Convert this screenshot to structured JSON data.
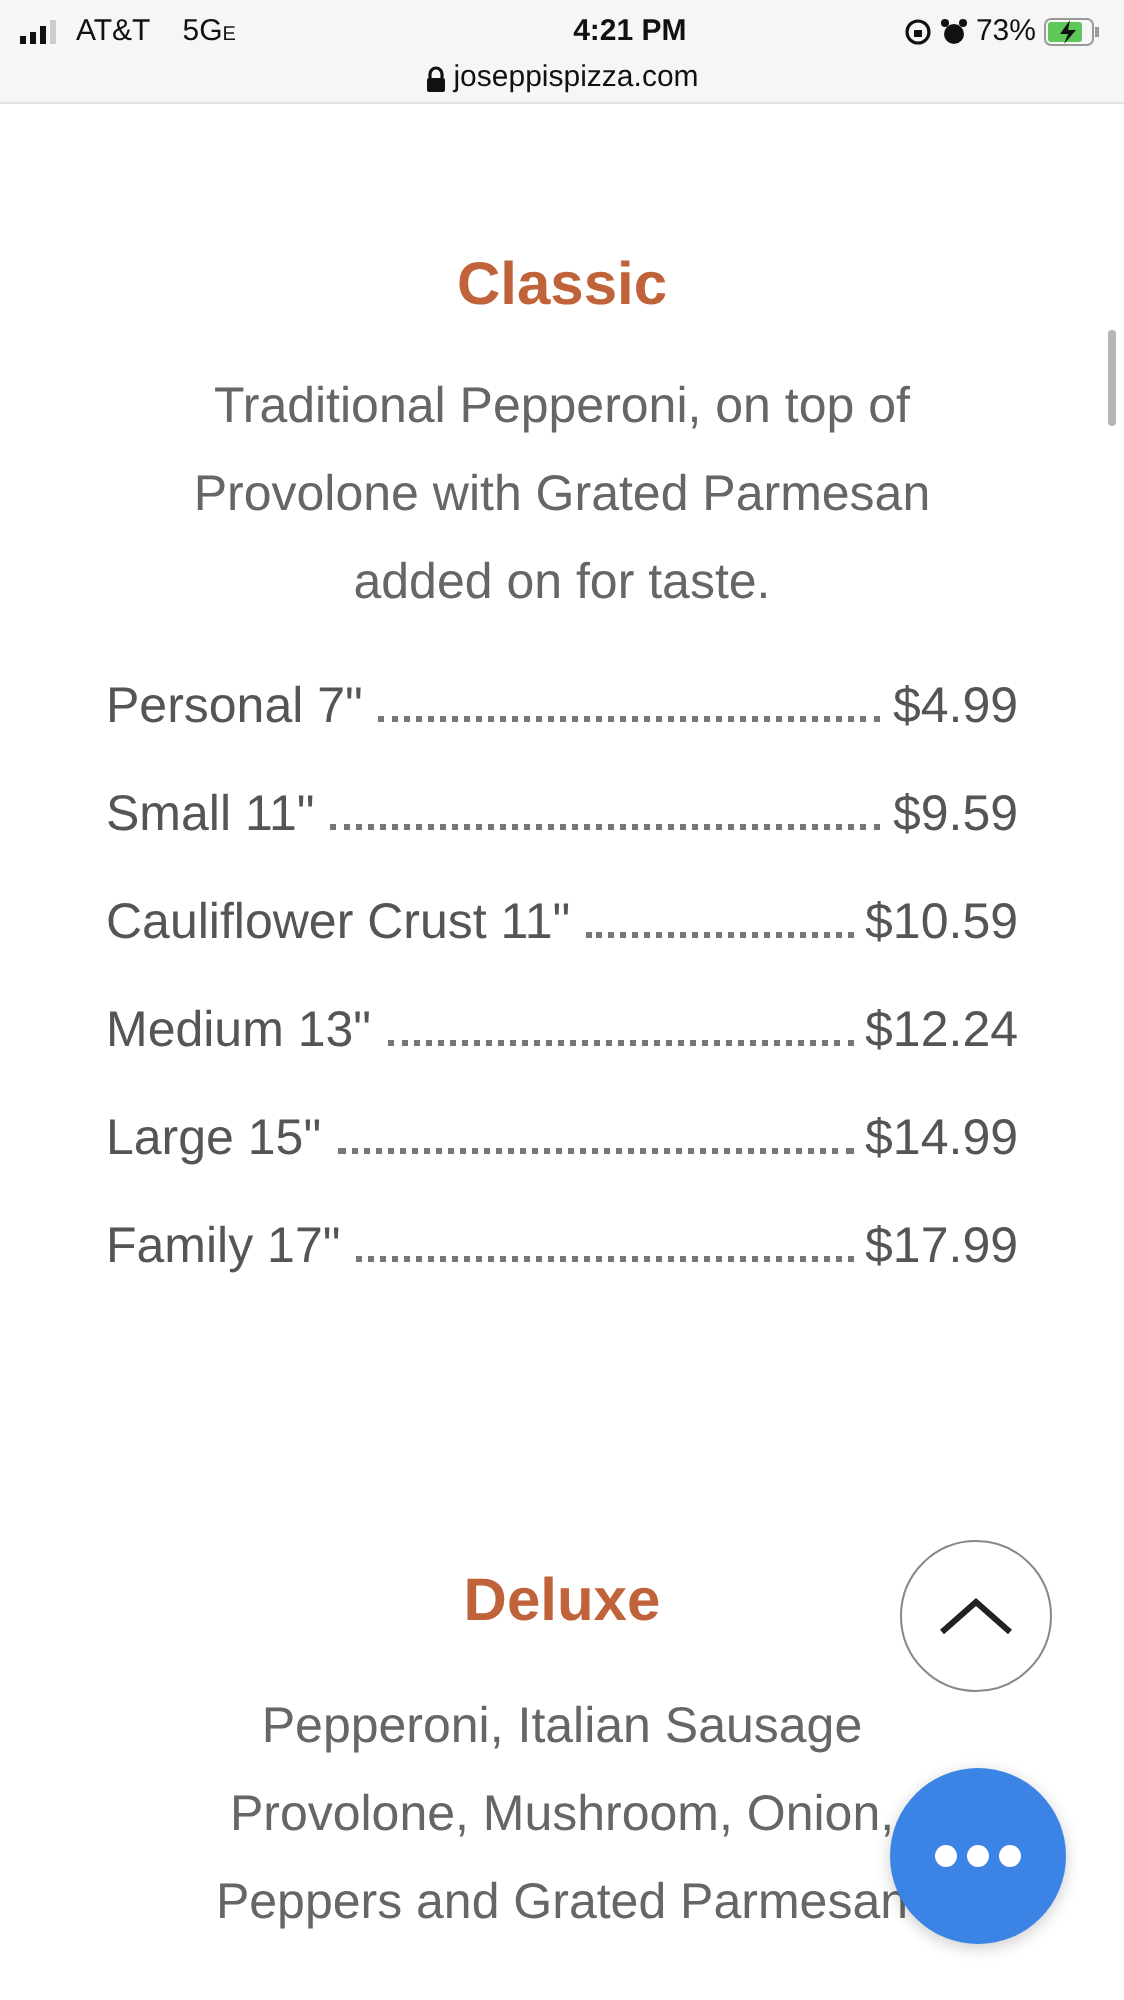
{
  "status_bar": {
    "carrier": "AT&T",
    "network": "5G",
    "network_suffix": "E",
    "time": "4:21 PM",
    "battery": "73%",
    "url": "joseppispizza.com"
  },
  "sections": [
    {
      "title": "Classic",
      "description_lines": [
        "Traditional Pepperoni, on top of",
        "Provolone with Grated Parmesan",
        "added on for taste."
      ],
      "prices": [
        {
          "size": "Personal 7\"",
          "price": "$4.99"
        },
        {
          "size": "Small 11\"",
          "price": "$9.59"
        },
        {
          "size": "Cauliflower Crust 11\"",
          "price": "$10.59"
        },
        {
          "size": "Medium 13\"",
          "price": "$12.24"
        },
        {
          "size": "Large 15\"",
          "price": "$14.99"
        },
        {
          "size": "Family 17\"",
          "price": "$17.99"
        }
      ]
    },
    {
      "title": "Deluxe",
      "description_lines": [
        "Pepperoni, Italian Sausage",
        "Provolone, Mushroom, Onion,",
        "Peppers and Grated Parmesan"
      ]
    }
  ]
}
